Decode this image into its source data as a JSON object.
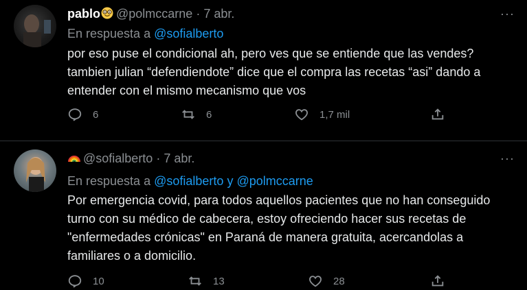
{
  "tweets": [
    {
      "name": "pablo",
      "name_emoji": "nerd-face-emoji",
      "handle": "@polmccarne",
      "separator": "·",
      "time": "7 abr.",
      "reply_prefix": "En respuesta a",
      "reply_to": "@sofialberto",
      "reply_joiner": "",
      "reply_to_2": "",
      "text": "por eso puse el condicional ah, pero ves que se entiende que las vendes? tambien julian “defendiendote” dice que el compra las recetas “asi” dando a entender con el mismo mecanismo que vos",
      "replies": "6",
      "retweets": "6",
      "likes": "1,7 mil",
      "more": "···"
    },
    {
      "name": "",
      "name_emoji": "rainbow-emoji",
      "handle": "@sofialberto",
      "separator": "·",
      "time": "7 abr.",
      "reply_prefix": "En respuesta a",
      "reply_to": "@sofialberto",
      "reply_joiner": "y",
      "reply_to_2": "@polmccarne",
      "text": "Por emergencia covid, para todos aquellos pacientes que no han conseguido turno con su médico de cabecera, estoy ofreciendo hacer sus recetas de \"enfermedades crónicas\" en Paraná de manera gratuita, acercandolas a familiares o a domicilio.",
      "replies": "10",
      "retweets": "13",
      "likes": "28",
      "more": "···"
    }
  ],
  "colors": {
    "link": "#1d9bf0",
    "muted": "#8b8f93",
    "text": "#e7e9ea",
    "background": "#000000"
  }
}
